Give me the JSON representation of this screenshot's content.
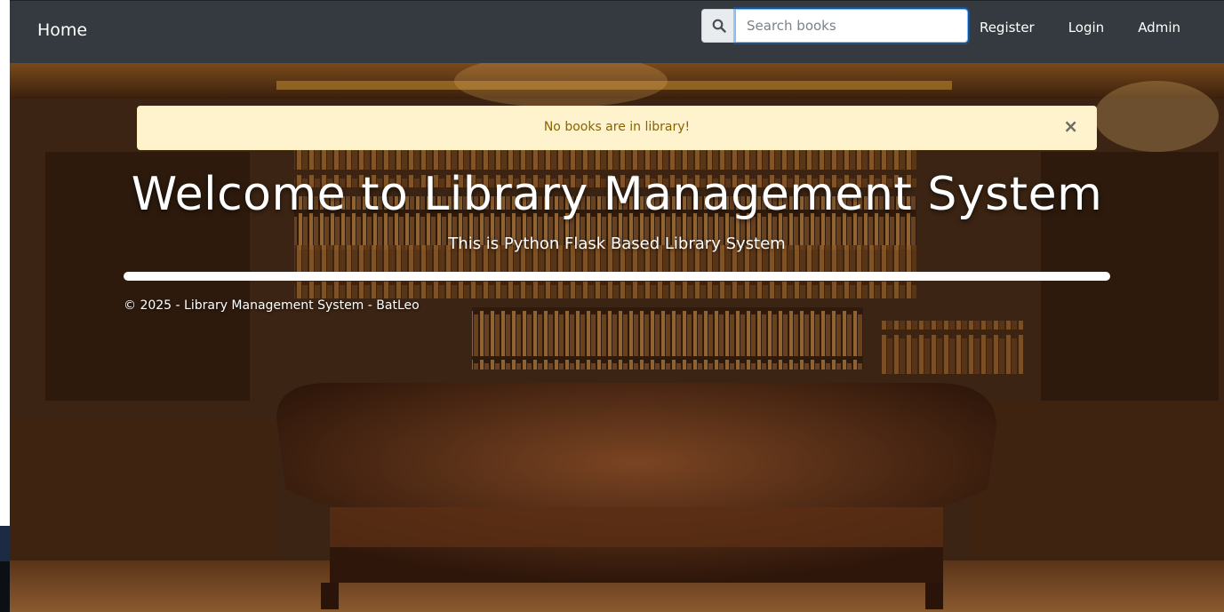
{
  "nav": {
    "home_label": "Home",
    "search_placeholder": "Search books",
    "links": [
      "Register",
      "Login",
      "Admin"
    ]
  },
  "alert": {
    "message": "No books are in library!",
    "close_symbol": "×"
  },
  "hero": {
    "title": "Welcome to Library Management System",
    "subtitle": "This is Python Flask Based Library System"
  },
  "footer": {
    "text": "© 2025 - Library Management System - BatLeo"
  },
  "colors": {
    "navbar": "#343a40",
    "alert_bg": "#fff3cd",
    "alert_text": "#856404"
  },
  "icons": {
    "search": "search-icon",
    "close": "close-icon"
  }
}
